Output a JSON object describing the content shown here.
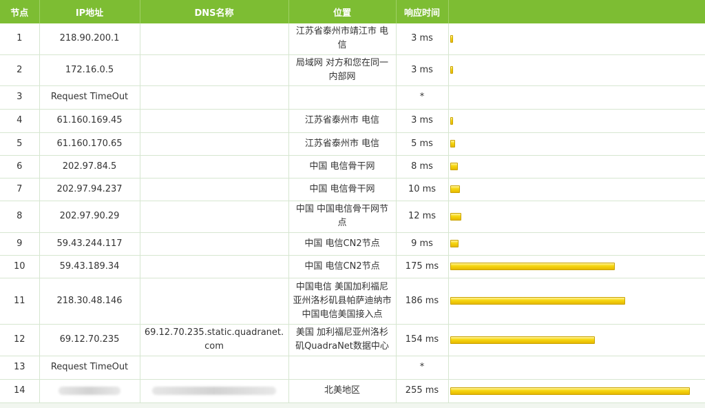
{
  "headers": {
    "node": "节点",
    "ip": "IP地址",
    "dns": "DNS名称",
    "location": "位置",
    "time": "响应时间"
  },
  "colors": {
    "header_bg": "#7dbd33",
    "bar_fill": "#f7d812"
  },
  "rows": [
    {
      "node": "1",
      "ip": "218.90.200.1",
      "dns": "",
      "location": "江苏省泰州市靖江市 电信",
      "time": "3 ms",
      "ms": 3
    },
    {
      "node": "2",
      "ip": "172.16.0.5",
      "dns": "",
      "location": "局域网 对方和您在同一内部网",
      "time": "3 ms",
      "ms": 3
    },
    {
      "node": "3",
      "ip": "Request TimeOut",
      "dns": "",
      "location": "",
      "time": "*",
      "ms": 0
    },
    {
      "node": "4",
      "ip": "61.160.169.45",
      "dns": "",
      "location": "江苏省泰州市 电信",
      "time": "3 ms",
      "ms": 3
    },
    {
      "node": "5",
      "ip": "61.160.170.65",
      "dns": "",
      "location": "江苏省泰州市 电信",
      "time": "5 ms",
      "ms": 5
    },
    {
      "node": "6",
      "ip": "202.97.84.5",
      "dns": "",
      "location": "中国 电信骨干网",
      "time": "8 ms",
      "ms": 8
    },
    {
      "node": "7",
      "ip": "202.97.94.237",
      "dns": "",
      "location": "中国 电信骨干网",
      "time": "10 ms",
      "ms": 10
    },
    {
      "node": "8",
      "ip": "202.97.90.29",
      "dns": "",
      "location": "中国 中国电信骨干网节点",
      "time": "12 ms",
      "ms": 12
    },
    {
      "node": "9",
      "ip": "59.43.244.117",
      "dns": "",
      "location": "中国 电信CN2节点",
      "time": "9 ms",
      "ms": 9
    },
    {
      "node": "10",
      "ip": "59.43.189.34",
      "dns": "",
      "location": "中国 电信CN2节点",
      "time": "175 ms",
      "ms": 175
    },
    {
      "node": "11",
      "ip": "218.30.48.146",
      "dns": "",
      "location": "中国电信 美国加利福尼亚州洛杉矶县帕萨迪纳市中国电信美国接入点",
      "time": "186 ms",
      "ms": 186
    },
    {
      "node": "12",
      "ip": "69.12.70.235",
      "dns": "69.12.70.235.static.quadranet.com",
      "location": "美国 加利福尼亚州洛杉矶QuadraNet数据中心",
      "time": "154 ms",
      "ms": 154
    },
    {
      "node": "13",
      "ip": "Request TimeOut",
      "dns": "",
      "location": "",
      "time": "*",
      "ms": 0
    },
    {
      "node": "14",
      "ip": "",
      "dns": "",
      "location": "北美地区",
      "time": "255 ms",
      "ms": 255
    }
  ]
}
